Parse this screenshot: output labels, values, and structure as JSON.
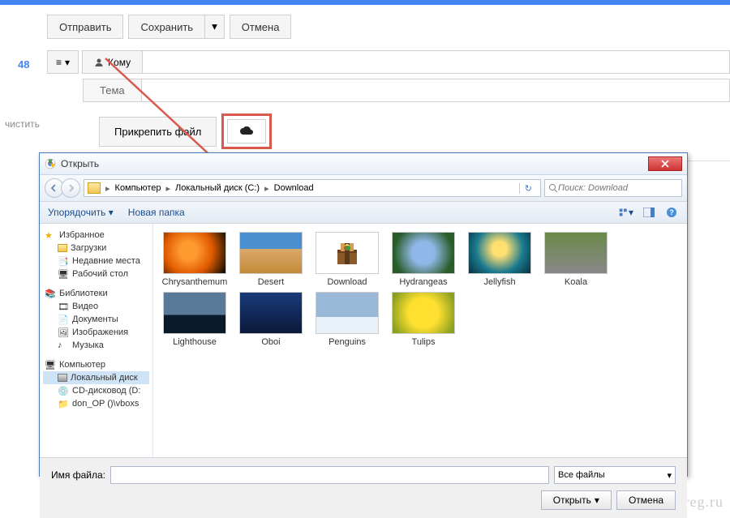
{
  "compose": {
    "send": "Отправить",
    "save": "Сохранить",
    "cancel": "Отмена",
    "badge": "48",
    "to_label": "Кому",
    "subject_label": "Тема",
    "attach": "Прикрепить файл",
    "clear": "чистить"
  },
  "dialog": {
    "title": "Открыть",
    "breadcrumb": [
      "Компьютер",
      "Локальный диск (C:)",
      "Download"
    ],
    "search_placeholder": "Поиск: Download",
    "toolbar": {
      "organize": "Упорядочить",
      "new_folder": "Новая папка"
    },
    "tree": {
      "favorites": {
        "head": "Избранное",
        "items": [
          "Загрузки",
          "Недавние места",
          "Рабочий стол"
        ]
      },
      "libraries": {
        "head": "Библиотеки",
        "items": [
          "Видео",
          "Документы",
          "Изображения",
          "Музыка"
        ]
      },
      "computer": {
        "head": "Компьютер",
        "items": [
          "Локальный диск",
          "CD-дисковод (D:",
          "don_OP ()\\vboxs"
        ]
      }
    },
    "files": [
      "Chrysanthemum",
      "Desert",
      "Download",
      "Hydrangeas",
      "Jellyfish",
      "Koala",
      "Lighthouse",
      "Oboi",
      "Penguins",
      "Tulips"
    ],
    "footer": {
      "filename_label": "Имя файла:",
      "filter": "Все файлы",
      "open": "Открыть",
      "cancel": "Отмена"
    }
  },
  "watermark": "webereg.ru"
}
